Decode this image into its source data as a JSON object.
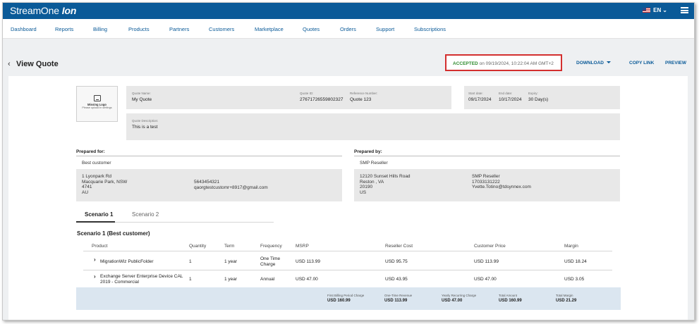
{
  "brand": {
    "name": "StreamOne",
    "product": "Ion"
  },
  "header": {
    "language": "EN"
  },
  "nav": [
    "Dashboard",
    "Reports",
    "Billing",
    "Products",
    "Partners",
    "Customers",
    "Marketplace",
    "Quotes",
    "Orders",
    "Support",
    "Subscriptions"
  ],
  "page": {
    "title": "View Quote"
  },
  "status": {
    "label": "ACCEPTED",
    "detail": "on 09/19/2024, 10:22:04 AM GMT+2"
  },
  "actions": {
    "download": "DOWNLOAD",
    "copy_link": "COPY LINK",
    "preview": "PREVIEW"
  },
  "logo": {
    "title": "Missing Logo",
    "subtitle": "Please upload in settings"
  },
  "quote": {
    "name_label": "Quote Name:",
    "name": "My Quote",
    "id_label": "Quote ID:",
    "id": "27671726559802327",
    "ref_label": "Reference Number:",
    "ref": "Quote 123",
    "start_label": "Start date:",
    "start": "09/17/2024",
    "end_label": "End date:",
    "end": "10/17/2024",
    "expiry_label": "Expiry:",
    "expiry": "30 Day(s)",
    "desc_label": "Quote Description:",
    "desc": "This is a test"
  },
  "prepared_for": {
    "heading": "Prepared for:",
    "name": "Best customer",
    "address": [
      "1 Lyonpark Rd",
      "Macquarie Park, NSW",
      "4741",
      "AU"
    ],
    "phone": "5643454321",
    "email": "qaorgtestcustomr+8917@gmail.com"
  },
  "prepared_by": {
    "heading": "Prepared by:",
    "name": "SMP Reseller",
    "address": [
      "12120 Sunset Hills Road",
      "Reston , VA",
      "20190",
      "US"
    ],
    "contact": [
      "SMP Reseller",
      "17033131222",
      "Yvette.Totino@tdsynnex.com"
    ]
  },
  "tabs": [
    "Scenario 1",
    "Scenario 2"
  ],
  "scenario_title": "Scenario 1 (Best customer)",
  "table": {
    "headers": [
      "Product",
      "Quantity",
      "Term",
      "Frequency",
      "MSRP",
      "Reseller Cost",
      "Customer Price",
      "Margin"
    ],
    "rows": [
      {
        "product": "MigrationWiz PublicFolder",
        "product2": "",
        "qty": "1",
        "term": "1 year",
        "freq": "One Time",
        "freq2": "Charge",
        "msrp": "USD 113.99",
        "cost": "USD 95.75",
        "price": "USD 113.99",
        "margin": "USD 18.24"
      },
      {
        "product": "Exchange Server Enterprise Device CAL",
        "product2": "2019 - Commercial",
        "qty": "1",
        "term": "1 year",
        "freq": "Annual",
        "freq2": "",
        "msrp": "USD 47.00",
        "cost": "USD 43.95",
        "price": "USD 47.00",
        "margin": "USD 3.05"
      }
    ]
  },
  "summary": [
    {
      "label": "First Billing Period Charge",
      "value": "USD 160.99"
    },
    {
      "label": "One-Time Revenue",
      "value": "USD 113.99"
    },
    {
      "label": "Yearly Recurring Charge",
      "value": "USD 47.00"
    },
    {
      "label": "Total Amount",
      "value": "USD 160.99"
    },
    {
      "label": "Total Margin",
      "value": "USD 21.29"
    }
  ],
  "colors": {
    "brand": "#0a5a98",
    "accepted": "#2e8b2e",
    "highlight": "#d32f2f",
    "summary_bg": "#dbe6f0"
  }
}
